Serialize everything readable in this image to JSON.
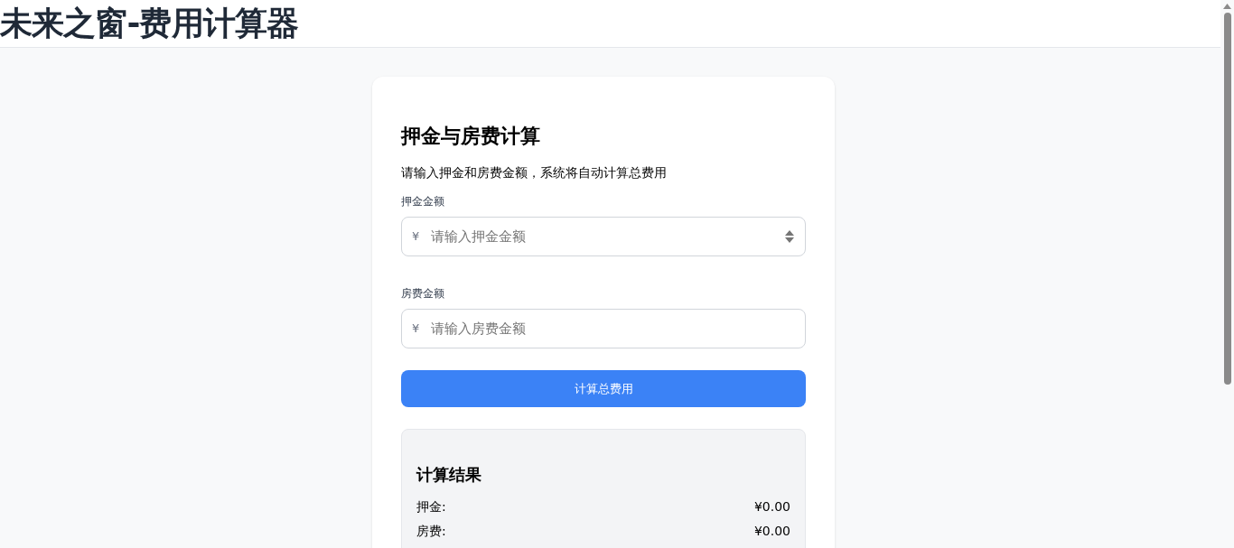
{
  "header": {
    "title": "未来之窗-费用计算器"
  },
  "card": {
    "title": "押金与房费计算",
    "description": "请输入押金和房费金额，系统将自动计算总费用",
    "fields": [
      {
        "label": "押金金额",
        "currency": "¥",
        "placeholder": "请输入押金金额",
        "kind": "number"
      },
      {
        "label": "房费金额",
        "currency": "¥",
        "placeholder": "请输入房费金额",
        "kind": "text"
      }
    ],
    "button": "计算总费用",
    "result": {
      "title": "计算结果",
      "rows": [
        {
          "label": "押金:",
          "value": "¥0.00"
        },
        {
          "label": "房费:",
          "value": "¥0.00"
        }
      ]
    }
  }
}
